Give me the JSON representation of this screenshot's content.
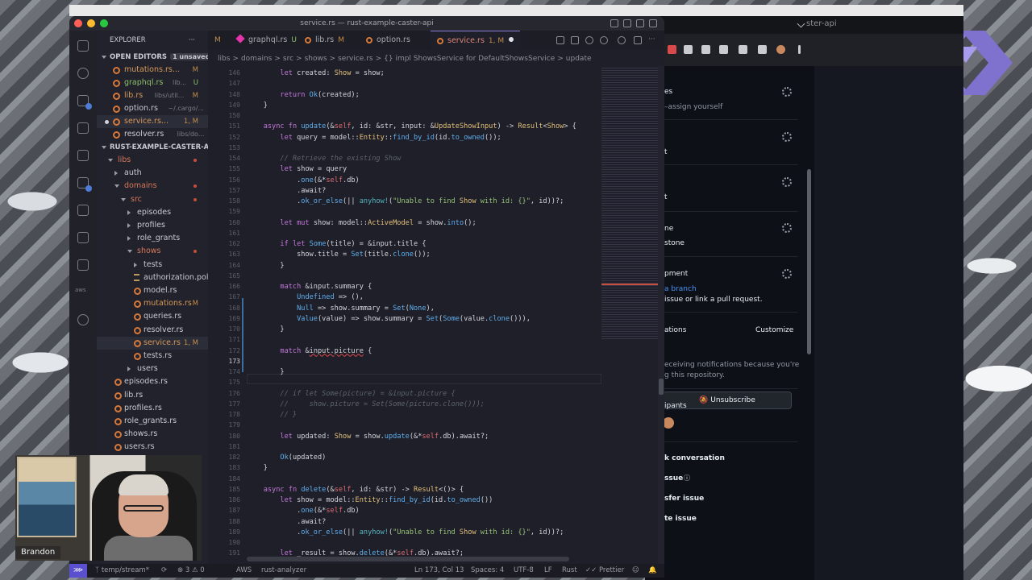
{
  "colors": {
    "accent": "#8c7bd6",
    "rust": "#d8793a",
    "modified": "#c58c4b",
    "error": "#e5484d"
  },
  "vscode": {
    "window_title": "service.rs — rust-example-caster-api",
    "tabs": [
      {
        "label": "M",
        "status": ""
      },
      {
        "label": "graphql.rs",
        "status": "U"
      },
      {
        "label": "lib.rs",
        "status": "M"
      },
      {
        "label": "option.rs",
        "status": ""
      },
      {
        "label": "service.rs",
        "status": "1, M"
      }
    ],
    "breadcrumb": [
      "libs",
      ">",
      "domains",
      ">",
      "src",
      ">",
      "shows",
      ">",
      "service.rs",
      ">",
      "{} impl ShowsService for DefaultShowsService",
      ">",
      "update"
    ],
    "explorer": {
      "title": "EXPLORER",
      "open_editors_label": "OPEN EDITORS",
      "unsaved_badge": "1 unsaved",
      "open_editors": [
        {
          "name": "mutations.rs...",
          "sub": "",
          "status": "M"
        },
        {
          "name": "graphql.rs",
          "sub": "lib...",
          "status": "U"
        },
        {
          "name": "lib.rs",
          "sub": "libs/util...",
          "status": "M"
        },
        {
          "name": "option.rs",
          "sub": "~/.cargo/...",
          "status": ""
        },
        {
          "name": "service.rs...",
          "sub": "",
          "status": "1, M"
        },
        {
          "name": "resolver.rs",
          "sub": "libs/do...",
          "status": ""
        }
      ],
      "project_label": "RUST-EXAMPLE-CASTER-API",
      "tree": [
        {
          "name": "libs"
        },
        {
          "name": "auth"
        },
        {
          "name": "domains"
        },
        {
          "name": "src"
        },
        {
          "name": "episodes"
        },
        {
          "name": "profiles"
        },
        {
          "name": "role_grants"
        },
        {
          "name": "shows"
        },
        {
          "name": "tests"
        },
        {
          "name": "authorization.polar"
        },
        {
          "name": "model.rs"
        },
        {
          "name": "mutations.rs",
          "status": "M"
        },
        {
          "name": "queries.rs"
        },
        {
          "name": "resolver.rs"
        },
        {
          "name": "service.rs",
          "status": "1, M"
        },
        {
          "name": "tests.rs"
        },
        {
          "name": "users"
        },
        {
          "name": "episodes.rs"
        },
        {
          "name": "lib.rs"
        },
        {
          "name": "profiles.rs"
        },
        {
          "name": "role_grants.rs"
        },
        {
          "name": "shows.rs"
        },
        {
          "name": "users.rs"
        }
      ]
    },
    "line_numbers": [
      "146",
      "147",
      "148",
      "149",
      "150",
      "151",
      "152",
      "153",
      "154",
      "155",
      "156",
      "157",
      "158",
      "159",
      "160",
      "161",
      "162",
      "163",
      "164",
      "165",
      "166",
      "167",
      "168",
      "169",
      "170",
      "171",
      "172",
      "173",
      "174",
      "175",
      "176",
      "177",
      "178",
      "179",
      "180",
      "181",
      "182",
      "183",
      "184",
      "185",
      "186",
      "187",
      "188",
      "189",
      "190",
      "191"
    ],
    "current_line": "173",
    "code": [
      "        let created: Show = show;",
      "",
      "        return Ok(created);",
      "    }",
      "",
      "    async fn update(&self, id: &str, input: &UpdateShowInput) -> Result<Show> {",
      "        let query = model::Entity::find_by_id(id.to_owned());",
      "",
      "        // Retrieve the existing Show",
      "        let show = query",
      "            .one(&*self.db)",
      "            .await?",
      "            .ok_or_else(|| anyhow!(\"Unable to find Show with id: {}\", id))?;",
      "",
      "        let mut show: model::ActiveModel = show.into();",
      "",
      "        if let Some(title) = &input.title {",
      "            show.title = Set(title.clone());",
      "        }",
      "",
      "        match &input.summary {",
      "            Undefined => (),",
      "            Null => show.summary = Set(None),",
      "            Value(value) => show.summary = Set(Some(value.clone())),",
      "        }",
      "",
      "        match &input.picture {",
      "",
      "        }",
      "",
      "        // if let Some(picture) = &input.picture {",
      "        //     show.picture = Set(Some(picture.clone()));",
      "        // }",
      "",
      "        let updated: Show = show.update(&*self.db).await?;",
      "",
      "        Ok(updated)",
      "    }",
      "",
      "    async fn delete(&self, id: &str) -> Result<()> {",
      "        let show = model::Entity::find_by_id(id.to_owned())",
      "            .one(&*self.db)",
      "            .await?",
      "            .ok_or_else(|| anyhow!(\"Unable to find Show with id: {}\", id))?;",
      "",
      "        let _result = show.delete(&*self.db).await?;"
    ],
    "status": {
      "branch": "temp/stream*",
      "problems": "3",
      "warnings": "0",
      "aws": "AWS",
      "lsp": "rust-analyzer",
      "cursor": "Ln 173, Col 13",
      "spaces": "Spaces: 4",
      "encoding": "UTF-8",
      "eol": "LF",
      "language": "Rust",
      "prettier": "Prettier"
    }
  },
  "browser": {
    "tab_title": "ster-api",
    "github": {
      "assignees_partial": "es",
      "assign_yourself": "–assign yourself",
      "labels_partial": "t",
      "projects_partial": "t",
      "milestone_partial": "ne",
      "milestone_value": "stone",
      "development_partial": "pment",
      "create_branch": "a branch",
      "dev_hint": "issue or link a pull request.",
      "notifications_partial": "ations",
      "customize": "Customize",
      "unsubscribe": "Unsubscribe",
      "notif_hint1": "eceiving notifications because you're",
      "notif_hint2": "g this repository.",
      "participants_partial": "ipants",
      "lock": "k conversation",
      "pin": "ssue",
      "transfer": "sfer issue",
      "delete": "te issue"
    }
  },
  "webcam": {
    "name": "Brandon"
  }
}
